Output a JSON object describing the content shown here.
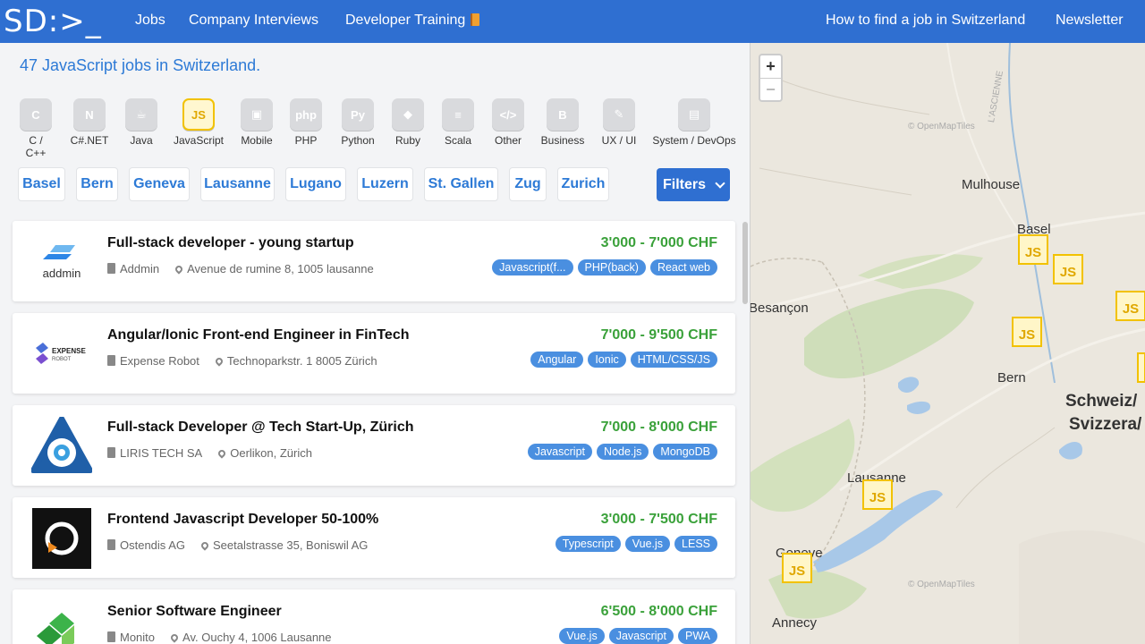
{
  "header": {
    "logo": "SD:>_",
    "nav_left": [
      "Jobs",
      "Company Interviews",
      "Developer Training"
    ],
    "nav_right": [
      "How to find a job in Switzerland",
      "Newsletter"
    ]
  },
  "headline": "47 JavaScript jobs in Switzerland.",
  "technologies": [
    {
      "label": "C / C++",
      "icon": "cpp-icon",
      "glyph": "C"
    },
    {
      "label": "C#.NET",
      "icon": "dotnet-icon",
      "glyph": "N"
    },
    {
      "label": "Java",
      "icon": "java-icon",
      "glyph": "☕"
    },
    {
      "label": "JavaScript",
      "icon": "javascript-icon",
      "glyph": "JS",
      "active": true
    },
    {
      "label": "Mobile",
      "icon": "android-icon",
      "glyph": "▣"
    },
    {
      "label": "PHP",
      "icon": "php-icon",
      "glyph": "php"
    },
    {
      "label": "Python",
      "icon": "python-icon",
      "glyph": "Py"
    },
    {
      "label": "Ruby",
      "icon": "ruby-icon",
      "glyph": "◆"
    },
    {
      "label": "Scala",
      "icon": "scala-icon",
      "glyph": "≡"
    },
    {
      "label": "Other",
      "icon": "code-icon",
      "glyph": "</>"
    },
    {
      "label": "Business",
      "icon": "business-icon",
      "glyph": "B"
    },
    {
      "label": "UX / UI",
      "icon": "ux-icon",
      "glyph": "✎"
    },
    {
      "label": "System / DevOps",
      "icon": "docker-icon",
      "glyph": "▤"
    }
  ],
  "cities": [
    "Basel",
    "Bern",
    "Geneva",
    "Lausanne",
    "Lugano",
    "Luzern",
    "St. Gallen",
    "Zug",
    "Zurich"
  ],
  "filters_label": "Filters",
  "jobs": [
    {
      "title": "Full-stack developer - young startup",
      "company": "Addmin",
      "location": "Avenue de rumine 8, 1005 lausanne",
      "salary": "3'000 - 7'000 CHF",
      "tags": [
        "Javascript(f...",
        "PHP(back)",
        "React web"
      ],
      "logo_text": "addmin"
    },
    {
      "title": "Angular/Ionic Front-end Engineer in FinTech",
      "company": "Expense Robot",
      "location": "Technoparkstr. 1 8005 Zürich",
      "salary": "7'000 - 9'500 CHF",
      "tags": [
        "Angular",
        "Ionic",
        "HTML/CSS/JS"
      ],
      "logo_text": "EXPENSE ROBOT"
    },
    {
      "title": "Full-stack Developer @ Tech Start-Up, Zürich",
      "company": "LIRIS TECH SA",
      "location": "Oerlikon, Zürich",
      "salary": "7'000 - 8'000 CHF",
      "tags": [
        "Javascript",
        "Node.js",
        "MongoDB"
      ],
      "logo_text": ""
    },
    {
      "title": "Frontend Javascript Developer 50-100%",
      "company": "Ostendis AG",
      "location": "Seetalstrasse 35, Boniswil AG",
      "salary": "3'000 - 7'500 CHF",
      "tags": [
        "Typescript",
        "Vue.js",
        "LESS"
      ],
      "logo_text": ""
    },
    {
      "title": "Senior Software Engineer",
      "company": "Monito",
      "location": "Av. Ouchy 4, 1006 Lausanne",
      "salary": "6'500 - 8'000 CHF",
      "tags": [
        "Vue.js",
        "Javascript",
        "PWA"
      ],
      "logo_text": ""
    }
  ],
  "map": {
    "zoom_in": "+",
    "zoom_out": "−",
    "pin_label": "JS",
    "labels": [
      "Mulhouse",
      "Basel",
      "Besançon",
      "Bern",
      "Schweiz/",
      "Svizzera/",
      "Lausanne",
      "Geneve",
      "Annecy",
      "L'ASCIENNE",
      "© OpenMapTiles",
      "© OpenMapTiles"
    ]
  }
}
